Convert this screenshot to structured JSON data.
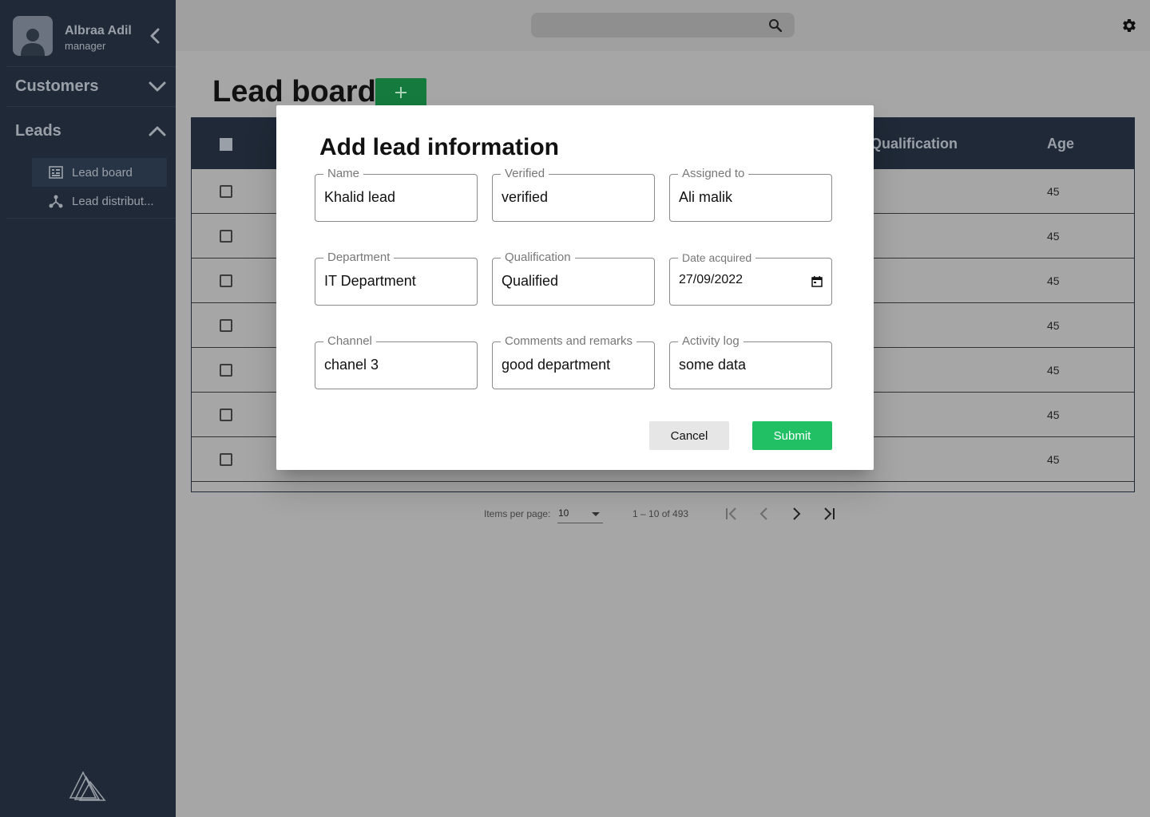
{
  "user": {
    "name": "Albraa Adil",
    "role": "manager"
  },
  "sidebar": {
    "groups": [
      {
        "title": "Customers",
        "expanded": false
      },
      {
        "title": "Leads",
        "expanded": true
      }
    ],
    "items": [
      {
        "label": "Lead board",
        "icon": "board-icon",
        "active": true
      },
      {
        "label": "Lead distribut...",
        "icon": "distribution-icon",
        "active": false
      }
    ]
  },
  "topbar": {
    "search_icon": "search-icon",
    "settings_icon": "gear-icon"
  },
  "page": {
    "title": "Lead board",
    "add_icon": "plus-icon"
  },
  "table": {
    "headers": {
      "qualification": "Qualification",
      "age": "Age"
    },
    "rows": [
      {
        "age": "45"
      },
      {
        "age": "45"
      },
      {
        "age": "45"
      },
      {
        "age": "45"
      },
      {
        "age": "45"
      },
      {
        "age": "45"
      },
      {
        "age": "45"
      }
    ]
  },
  "paginator": {
    "items_per_page_label": "Items per page:",
    "page_size": "10",
    "range": "1 – 10 of 493"
  },
  "dialog": {
    "title": "Add lead information",
    "fields": {
      "name": {
        "label": "Name",
        "value": "Khalid lead",
        "placeholder": "Name"
      },
      "verified": {
        "label": "Verified",
        "value": "verified"
      },
      "assigned_to": {
        "label": "Assigned to",
        "value": "Ali malik"
      },
      "department": {
        "label": "Department",
        "value": "IT Department"
      },
      "qualification": {
        "label": "Qualification",
        "value": "Qualified"
      },
      "date_acquired": {
        "label": "Date acquired",
        "value": "27/09/2022"
      },
      "channel": {
        "label": "Channel",
        "value": "chanel 3"
      },
      "comments": {
        "label": "Comments and remarks",
        "value": "good department"
      },
      "activity_log": {
        "label": "Activity log",
        "value": "some data"
      }
    },
    "cancel_label": "Cancel",
    "submit_label": "Submit"
  },
  "colors": {
    "sidebar_bg": "#1f2937",
    "overlay_bg": "#a6a6a6",
    "add_button": "#157a3e",
    "submit_button": "#22c064"
  }
}
